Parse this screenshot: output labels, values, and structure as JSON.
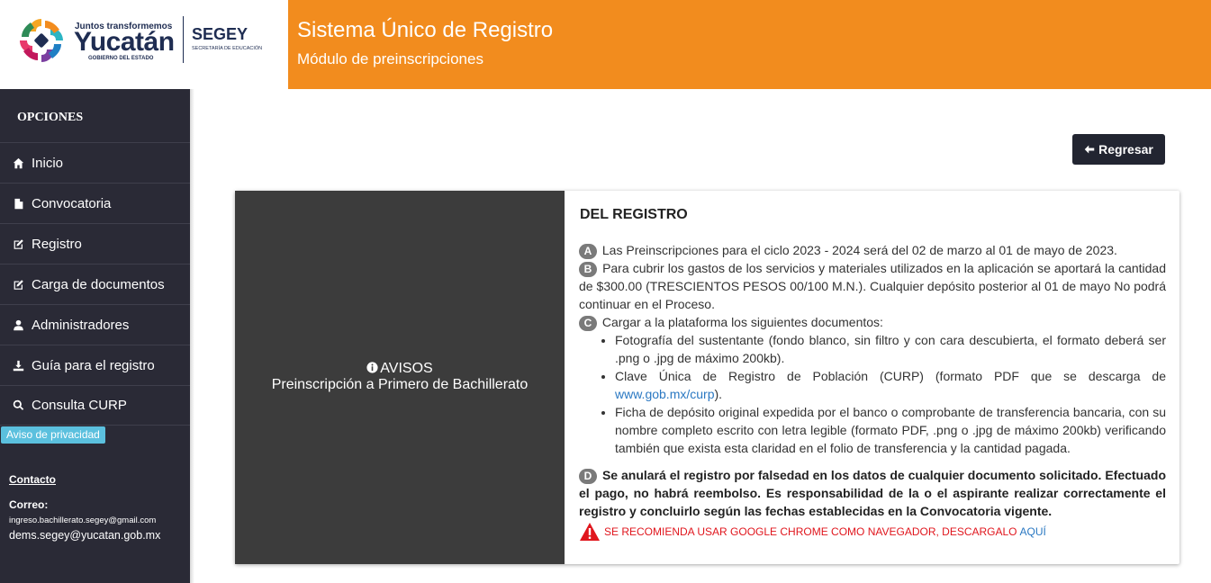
{
  "logo": {
    "tagline": "Juntos transformemos",
    "name": "Yucatán",
    "government": "GOBIERNO DEL ESTADO",
    "agency": "SEGEY",
    "agency_full": "SECRETARÍA DE EDUCACIÓN"
  },
  "banner": {
    "title": "Sistema Único de Registro",
    "subtitle": "Módulo de preinscripciones"
  },
  "sidebar": {
    "title": "OPCIONES",
    "items": [
      {
        "label": "Inicio",
        "icon": "home-icon"
      },
      {
        "label": "Convocatoria",
        "icon": "file-icon"
      },
      {
        "label": "Registro",
        "icon": "edit-icon"
      },
      {
        "label": "Carga de documentos",
        "icon": "edit-icon"
      },
      {
        "label": "Administradores",
        "icon": "user-icon"
      },
      {
        "label": "Guía para el registro",
        "icon": "download-icon"
      },
      {
        "label": "Consulta CURP",
        "icon": "search-icon"
      }
    ],
    "privacy": "Aviso de privacidad",
    "contact_title": "Contacto",
    "contact_label": "Correo:",
    "email_1": "ingreso.bachillerato.segey@gmail.com",
    "email_2": "dems.segey@yucatan.gob.mx"
  },
  "back_button": "Regresar",
  "notice": {
    "heading": "AVISOS",
    "subheading": "Preinscripción a Primero de Bachillerato"
  },
  "registration": {
    "title": "DEL REGISTRO",
    "a_letter": "A",
    "a_text": "Las Preinscripciones para el ciclo 2023 - 2024 será del 02 de marzo al 01 de mayo de 2023.",
    "b_letter": "B",
    "b_text": "Para cubrir los gastos de los servicios y materiales utilizados en la aplicación se aportará la cantidad de $300.00 (TRESCIENTOS PESOS 00/100 M.N.). Cualquier depósito posterior al 01 de mayo No podrá continuar en el Proceso.",
    "c_letter": "C",
    "c_text": "Cargar a la plataforma los siguientes documentos:",
    "doc_1": "Fotografía del sustentante (fondo blanco, sin filtro y con cara descubierta, el formato deberá ser .png o .jpg de máximo 200kb).",
    "doc_2_pre": "Clave Única de Registro de Población (CURP) (formato PDF que se descarga de ",
    "doc_2_link": "www.gob.mx/curp",
    "doc_2_post": ").",
    "doc_3": "Ficha de depósito original expedida por el banco o comprobante de transferencia bancaria, con su nombre completo escrito con letra legible (formato PDF, .png o .jpg de máximo 200kb) verificando también que exista esta claridad en el folio de transferencia y la cantidad pagada.",
    "d_letter": "D",
    "d_text": "Se anulará el registro por falsedad en los datos de cualquier documento solicitado. Efectuado el pago, no habrá reembolso. Es responsabilidad de la o el aspirante realizar correctamente el registro y concluirlo según las fechas establecidas en la Convocatoria vigente.",
    "warning": "SE RECOMIENDA USAR GOOGLE CHROME COMO NAVEGADOR, DESCARGALO",
    "warning_link": "AQUÍ"
  },
  "colors": {
    "banner": "#f28c1e",
    "sidebar": "#2a2a36",
    "notice_panel": "#3c3c3c",
    "warning": "#e0161d",
    "link": "#2a78c2",
    "privacy_badge": "#5bc0de"
  }
}
